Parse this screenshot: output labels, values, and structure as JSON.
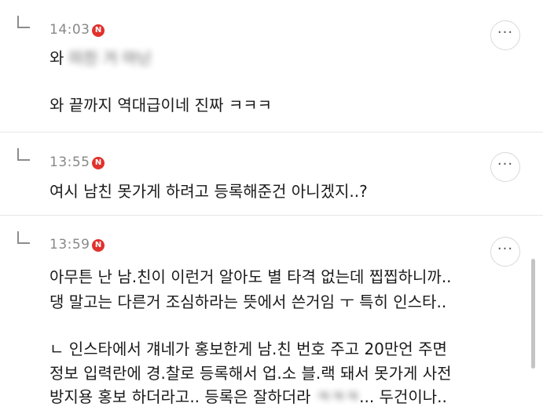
{
  "comments": [
    {
      "time": "14:03",
      "badge": "N",
      "more": "···",
      "lines": [
        "와 ",
        "와 끝까지 역대급이네 진짜 ㅋㅋㅋ"
      ],
      "blurred_fragment": "미친 거 아닌"
    },
    {
      "time": "13:55",
      "badge": "N",
      "more": "···",
      "lines": [
        "여시 남친 못가게 하려고 등록해준건 아니겠지..?"
      ]
    },
    {
      "time": "13:59",
      "badge": "N",
      "more": "···",
      "lines": [
        "아무튼 난 남.친이 이런거 알아도 별 타격 없는데 찝찝하니까..",
        "댕 말고는 다른거 조심하라는 뜻에서 쓴거임 ㅜ 특히 인스타..",
        "ㄴ 인스타에서 걔네가 홍보한게 남.친 번호 주고 20만언 주면",
        "정보 입력란에 경.찰로 등록해서 업.소 블.랙 돼서 못가게 사전",
        "방지용 홍보 하더라고.. 등록은 잘하더라 ",
        "... 두건이나.."
      ],
      "blurred_fragment": "ㅋㅋㅋ"
    }
  ]
}
